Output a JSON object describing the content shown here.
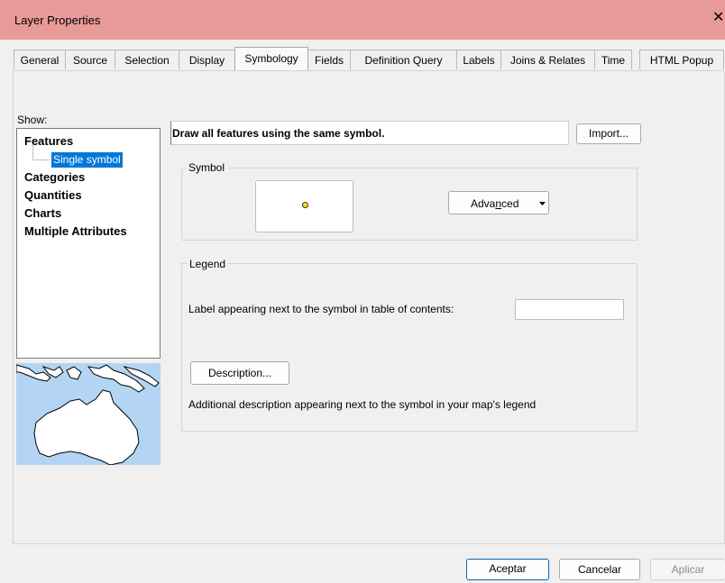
{
  "window": {
    "title": "Layer Properties",
    "close_glyph": "✕"
  },
  "tabs": [
    {
      "label": "General"
    },
    {
      "label": "Source"
    },
    {
      "label": "Selection"
    },
    {
      "label": "Display"
    },
    {
      "label": "Symbology",
      "active": true
    },
    {
      "label": "Fields"
    },
    {
      "label": "Definition Query"
    },
    {
      "label": "Labels"
    },
    {
      "label": "Joins & Relates"
    },
    {
      "label": "Time"
    },
    {
      "label": "HTML Popup"
    }
  ],
  "show": {
    "label": "Show:",
    "items": [
      "Features",
      "Single symbol",
      "Categories",
      "Quantities",
      "Charts",
      "Multiple Attributes"
    ],
    "selected": "Single symbol"
  },
  "symbology": {
    "heading": "Draw all features using the same symbol.",
    "import_button": "Import...",
    "symbol_group": "Symbol",
    "symbol_color": "#f7e30b",
    "advanced_button": "Advanced",
    "advanced_underline_letter": "n",
    "legend_group": "Legend",
    "label_prompt": "Label appearing next to the symbol in table of contents:",
    "label_value": "",
    "description_button": "Description...",
    "description_text": "Additional description appearing next to the symbol in your map's legend"
  },
  "footer": {
    "ok_label": "Aceptar",
    "cancel_label": "Cancelar",
    "apply_label": "Aplicar"
  },
  "colors": {
    "titlebar": "#e89a98",
    "selection": "#0078d7",
    "preview_water": "#b3d4f3",
    "preview_land": "#ffffff"
  }
}
